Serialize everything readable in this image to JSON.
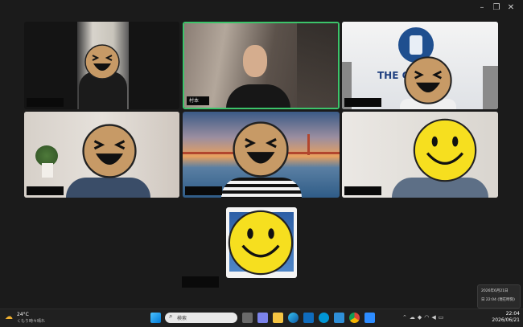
{
  "window_controls": {
    "minimize": "–",
    "restore": "❐",
    "close": "✕"
  },
  "tiles": [
    {
      "id": "t1",
      "name": "",
      "face": "laughing",
      "highlighted": false
    },
    {
      "id": "t2",
      "name": "村本",
      "face": "none",
      "highlighted": true
    },
    {
      "id": "t3",
      "name": "",
      "face": "laughing",
      "highlighted": false,
      "sign_text": "THE GUND",
      "logo_text": "THE GUNDAM BASE"
    },
    {
      "id": "t4",
      "name": "",
      "face": "laughing",
      "highlighted": false
    },
    {
      "id": "t5",
      "name": "",
      "face": "laughing",
      "highlighted": false
    },
    {
      "id": "t6",
      "name": "",
      "face": "smiley",
      "highlighted": false
    },
    {
      "id": "t7",
      "name": "",
      "face": "smiley",
      "highlighted": false
    }
  ],
  "colors": {
    "active_speaker_border": "#3cc46a",
    "laughing_face": "#c79a66",
    "smiley_face": "#f6df1f",
    "taskbar": "#202020"
  },
  "weather": {
    "temp": "24°C",
    "desc": "くもり時々晴れ"
  },
  "search": {
    "placeholder": "検索"
  },
  "clock": {
    "time": "22:04",
    "date": "2026/06/21"
  },
  "popup": {
    "line1": "2026年6月21日",
    "line2": "日 22:04 (現在時刻)"
  },
  "taskbar_icons": [
    "start-icon",
    "search-icon",
    "file-explorer-icon",
    "teams-icon",
    "folder-icon",
    "edge-icon",
    "chrome-icon",
    "store-icon",
    "hp-icon",
    "shield-icon",
    "chrome2-icon",
    "zoom-icon"
  ]
}
